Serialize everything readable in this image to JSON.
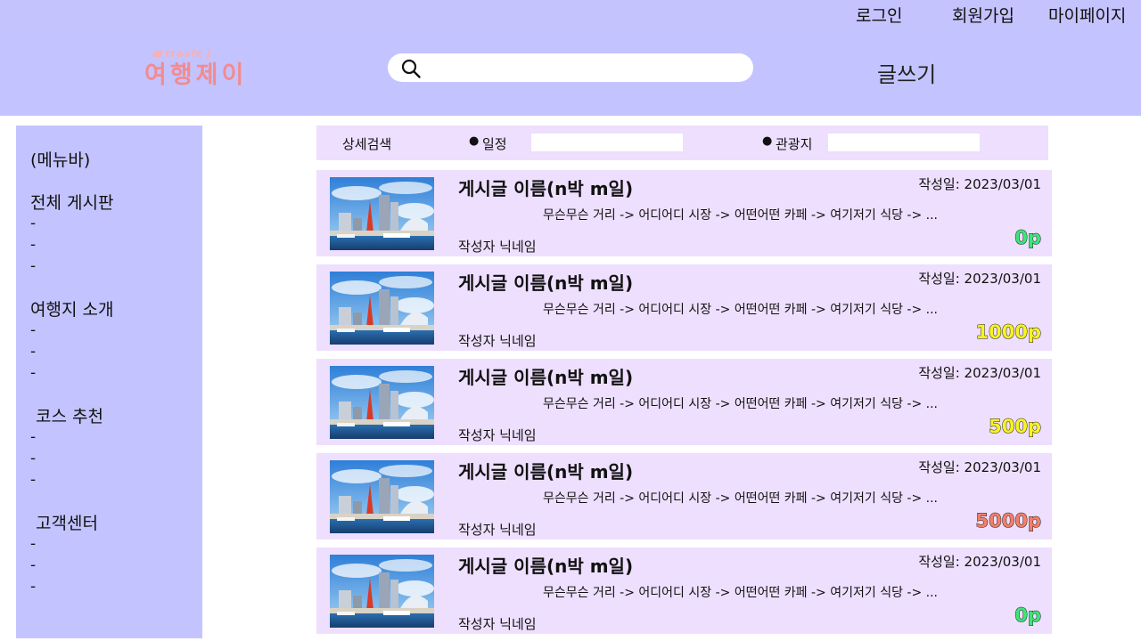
{
  "topbar": {
    "login": "로그인",
    "signup": "회원가입",
    "mypage": "마이페이지"
  },
  "header": {
    "logo_sub": "travle J",
    "logo_main": "여행제이",
    "search_value": "",
    "write_label": "글쓰기"
  },
  "sidebar": {
    "menu_title": "(메뉴바)",
    "sections": [
      {
        "label": "전체 게시판",
        "items": [
          "-",
          "-",
          "-"
        ]
      },
      {
        "label": "여행지 소개",
        "items": [
          "-",
          "-",
          "-"
        ]
      },
      {
        "label": "코스 추천",
        "items": [
          "-",
          "-",
          "-"
        ]
      },
      {
        "label": "고객센터",
        "items": [
          "-",
          "-",
          "-"
        ]
      }
    ]
  },
  "detail_search": {
    "label": "상세검색",
    "schedule_label": "일정",
    "schedule_value": "",
    "spot_label": "관광지",
    "spot_value": ""
  },
  "posts": [
    {
      "title": "게시글 이름(n박 m일)",
      "date": "작성일: 2023/03/01",
      "route": "무슨무슨 거리 -> 어디어디 시장 -> 어떤어떤 카페 -> 여기저기 식당 -> ...",
      "author": "작성자 닉네임",
      "points": "0p",
      "points_color": "#3ee57a"
    },
    {
      "title": "게시글 이름(n박 m일)",
      "date": "작성일: 2023/03/01",
      "route": "무슨무슨 거리 -> 어디어디 시장 -> 어떤어떤 카페 -> 여기저기 식당 -> ...",
      "author": "작성자 닉네임",
      "points": "1000p",
      "points_color": "#f7f224"
    },
    {
      "title": "게시글 이름(n박 m일)",
      "date": "작성일: 2023/03/01",
      "route": "무슨무슨 거리 -> 어디어디 시장 -> 어떤어떤 카페 -> 여기저기 식당 -> ...",
      "author": "작성자 닉네임",
      "points": "500p",
      "points_color": "#f7f224"
    },
    {
      "title": "게시글 이름(n박 m일)",
      "date": "작성일: 2023/03/01",
      "route": "무슨무슨 거리 -> 어디어디 시장 -> 어떤어떤 카페 -> 여기저기 식당 -> ...",
      "author": "작성자 닉네임",
      "points": "5000p",
      "points_color": "#f27f6a"
    },
    {
      "title": "게시글 이름(n박 m일)",
      "date": "작성일: 2023/03/01",
      "route": "무슨무슨 거리 -> 어디어디 시장 -> 어떤어떤 카페 -> 여기저기 식당 -> ...",
      "author": "작성자 닉네임",
      "points": "0p",
      "points_color": "#3ee57a"
    }
  ]
}
